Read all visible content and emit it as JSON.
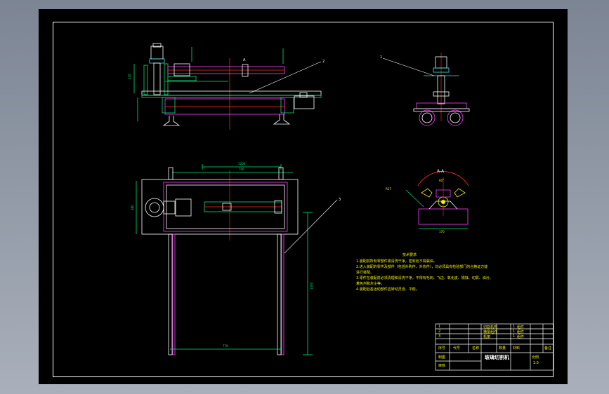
{
  "drawing": {
    "section_title": "A-A",
    "section_marker": "A",
    "notes_title": "技术要求",
    "notes": [
      "1.装配前所有零部件需清洗干净，密封处不得漏油。",
      "2.进入装配的零件及部件（包括外购件、外协件），均必须具有检验部门的合格证方能",
      "进行装配。",
      "3.零件在装配前必须清理和清洗干净，不得有毛刺、飞边、氧化皮、锈蚀、切屑、油污、",
      "着色剂和灰尘等。",
      "4.装配后各运动部件应转动灵活、平稳。"
    ],
    "callouts": [
      "1",
      "2",
      "3"
    ],
    "dims": {
      "top_width": "1200",
      "height_left": "335",
      "plan_width": "700",
      "plan_height": "380",
      "leg_height": "1400",
      "base_width": "770",
      "section_r": "R27",
      "section_base": "170",
      "section_angle": "60°"
    }
  },
  "title_block": {
    "title": "玻璃切割机",
    "scale": "1:5",
    "headers": [
      "序号",
      "代号",
      "名称",
      "数量",
      "材料",
      "备注"
    ],
    "rows": [
      [
        "1",
        "",
        "切割机构",
        "1",
        "组件",
        ""
      ],
      [
        "2",
        "",
        "横梁组件",
        "1",
        "组件",
        ""
      ],
      [
        "3",
        "",
        "机架",
        "1",
        "组件",
        ""
      ]
    ],
    "labels": [
      "制图",
      "审核",
      "比例"
    ]
  },
  "colors": {
    "background": "#000000",
    "line": "#ffffff",
    "dimension": "#00e676",
    "hidden": "#ff40ff",
    "center": "#ff3030",
    "annotation": "#f2f200",
    "cyan": "#40e0e0"
  }
}
